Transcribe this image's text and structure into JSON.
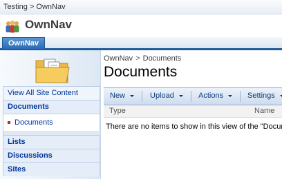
{
  "global_breadcrumb": {
    "parent": "Testing",
    "separator": ">",
    "current": "OwnNav"
  },
  "site": {
    "title": "OwnNav",
    "icon": "people-group-icon"
  },
  "top_nav": {
    "tabs": [
      {
        "label": "OwnNav"
      }
    ]
  },
  "quick_launch": {
    "view_all": "View All Site Content",
    "documents_heading": "Documents",
    "documents_item": "Documents",
    "lists": "Lists",
    "discussions": "Discussions",
    "sites": "Sites"
  },
  "page": {
    "breadcrumb": {
      "parent": "OwnNav",
      "separator": ">",
      "current": "Documents"
    },
    "title": "Documents",
    "icon": "folder-documents-icon"
  },
  "toolbar": {
    "new": "New",
    "upload": "Upload",
    "actions": "Actions",
    "settings": "Settings"
  },
  "list": {
    "columns": [
      "Type",
      "Name"
    ],
    "empty_message": "There are no items to show in this view of the \"Docum"
  },
  "colors": {
    "accent": "#215b96",
    "link": "#003399",
    "bullet": "#c0272d"
  }
}
